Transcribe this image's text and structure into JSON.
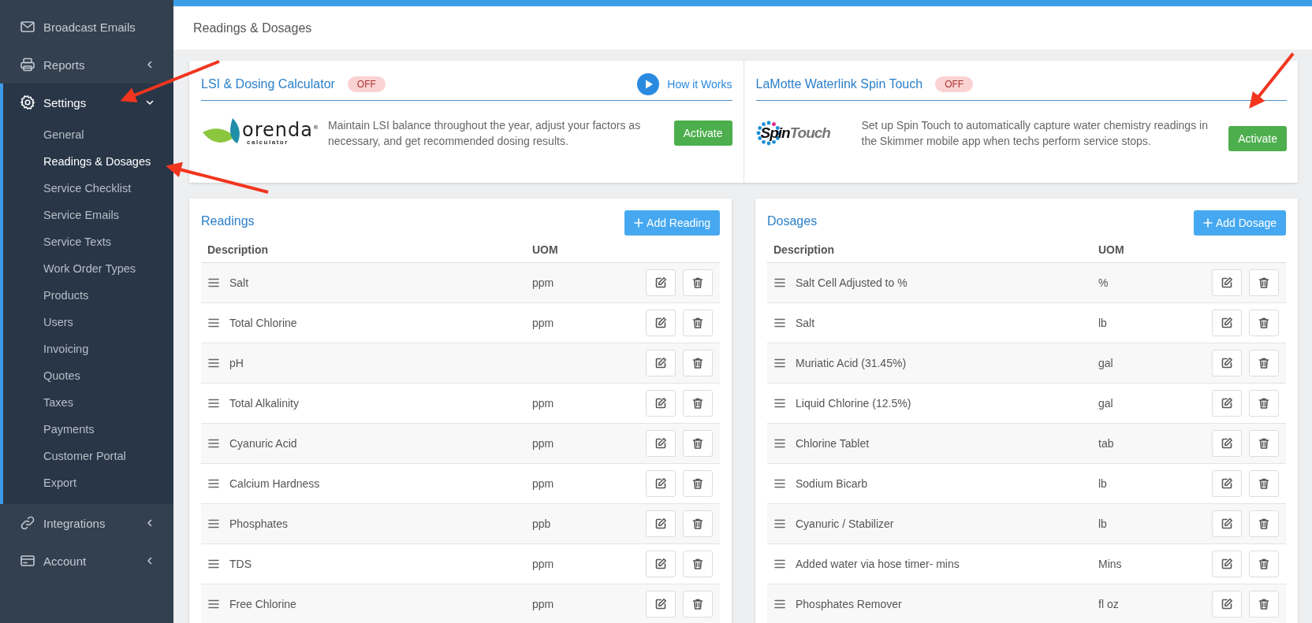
{
  "sidebar": {
    "items": [
      {
        "label": "Broadcast Emails",
        "kind": "link"
      },
      {
        "label": "Reports",
        "kind": "group",
        "expanded": false
      },
      {
        "label": "Settings",
        "kind": "group",
        "expanded": true,
        "children": [
          {
            "label": "General",
            "selected": false
          },
          {
            "label": "Readings & Dosages",
            "selected": true
          },
          {
            "label": "Service Checklist",
            "selected": false
          },
          {
            "label": "Service Emails",
            "selected": false
          },
          {
            "label": "Service Texts",
            "selected": false
          },
          {
            "label": "Work Order Types",
            "selected": false
          },
          {
            "label": "Products",
            "selected": false
          },
          {
            "label": "Users",
            "selected": false
          },
          {
            "label": "Invoicing",
            "selected": false
          },
          {
            "label": "Quotes",
            "selected": false
          },
          {
            "label": "Taxes",
            "selected": false
          },
          {
            "label": "Payments",
            "selected": false
          },
          {
            "label": "Customer Portal",
            "selected": false
          },
          {
            "label": "Export",
            "selected": false
          }
        ]
      },
      {
        "label": "Integrations",
        "kind": "group",
        "expanded": false
      },
      {
        "label": "Account",
        "kind": "group",
        "expanded": false
      }
    ]
  },
  "page_title": "Readings & Dosages",
  "integrations": [
    {
      "title": "LSI & Dosing Calculator",
      "status": "OFF",
      "on": false,
      "help_link": "How it Works",
      "logo": {
        "kind": "orenda",
        "name": "orenda",
        "mark": "®",
        "subtitle": "calculator"
      },
      "description": "Maintain LSI balance throughout the year, adjust your factors as necessary, and get recommended dosing results.",
      "button": "Activate"
    },
    {
      "title": "LaMotte Waterlink Spin Touch",
      "status": "OFF",
      "on": false,
      "logo": {
        "kind": "spintouch",
        "name": "Spin",
        "name_2": "Touch"
      },
      "description": "Set up Spin Touch to automatically capture water chemistry readings in the Skimmer mobile app when techs perform service stops.",
      "button": "Activate"
    }
  ],
  "tables": [
    {
      "title": "Readings",
      "add_button": "Add Reading",
      "columns": [
        "Description",
        "UOM"
      ],
      "rows": [
        {
          "description": "Salt",
          "uom": "ppm"
        },
        {
          "description": "Total Chlorine",
          "uom": "ppm"
        },
        {
          "description": "pH"
        },
        {
          "description": "Total Alkalinity",
          "uom": "ppm"
        },
        {
          "description": "Cyanuric Acid",
          "uom": "ppm"
        },
        {
          "description": "Calcium Hardness",
          "uom": "ppm"
        },
        {
          "description": "Phosphates",
          "uom": "ppb"
        },
        {
          "description": "TDS",
          "uom": "ppm"
        },
        {
          "description": "Free Chlorine",
          "uom": "ppm"
        }
      ]
    },
    {
      "title": "Dosages",
      "add_button": "Add Dosage",
      "columns": [
        "Description",
        "UOM"
      ],
      "rows": [
        {
          "description": "Salt Cell Adjusted to %",
          "uom": "%"
        },
        {
          "description": "Salt",
          "uom": "lb"
        },
        {
          "description": "Muriatic Acid (31.45%)",
          "uom": "gal"
        },
        {
          "description": "Liquid Chlorine (12.5%)",
          "uom": "gal"
        },
        {
          "description": "Chlorine Tablet",
          "uom": "tab"
        },
        {
          "description": "Sodium Bicarb",
          "uom": "lb"
        },
        {
          "description": "Cyanuric / Stabilizer",
          "uom": "lb"
        },
        {
          "description": "Added water via hose timer- mins",
          "uom": "Mins"
        },
        {
          "description": "Phosphates Remover",
          "uom": "fl oz"
        }
      ]
    }
  ]
}
